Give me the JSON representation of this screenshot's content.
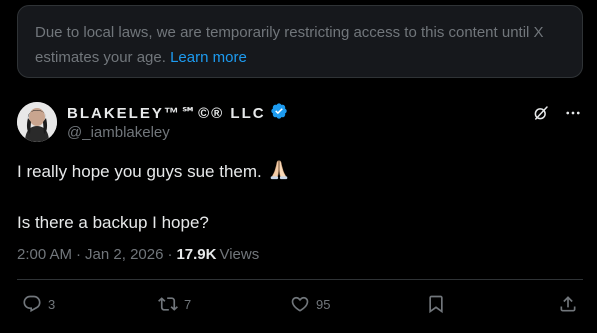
{
  "notice": {
    "text": "Due to local laws, we are temporarily restricting access to this content until X estimates your age.",
    "link": "Learn more"
  },
  "author": {
    "display_name": "BLAKELEY™℠©® LLC",
    "handle": "@_iamblakeley",
    "verified": true
  },
  "tweet": {
    "line1": "I really hope you guys sue them.",
    "line2": "Is there a backup I hope?"
  },
  "meta": {
    "time": "2:00 AM",
    "separator": "·",
    "date": "Jan 2, 2026",
    "separator2": "·",
    "views_count": "17.9K",
    "views_label": "Views"
  },
  "actions": {
    "replies": "3",
    "reposts": "7",
    "likes": "95"
  },
  "colors": {
    "background": "#000000",
    "text": "#e7e9ea",
    "muted": "#71767b",
    "accent": "#1d9bf0",
    "border": "#2f3336"
  },
  "icons": {
    "verified": "verified-badge-icon",
    "grok": "grok-icon",
    "more": "more-icon",
    "reply": "reply-icon",
    "repost": "repost-icon",
    "like": "heart-icon",
    "bookmark": "bookmark-icon",
    "share": "share-icon",
    "emoji": "folded-hands-emoji"
  }
}
